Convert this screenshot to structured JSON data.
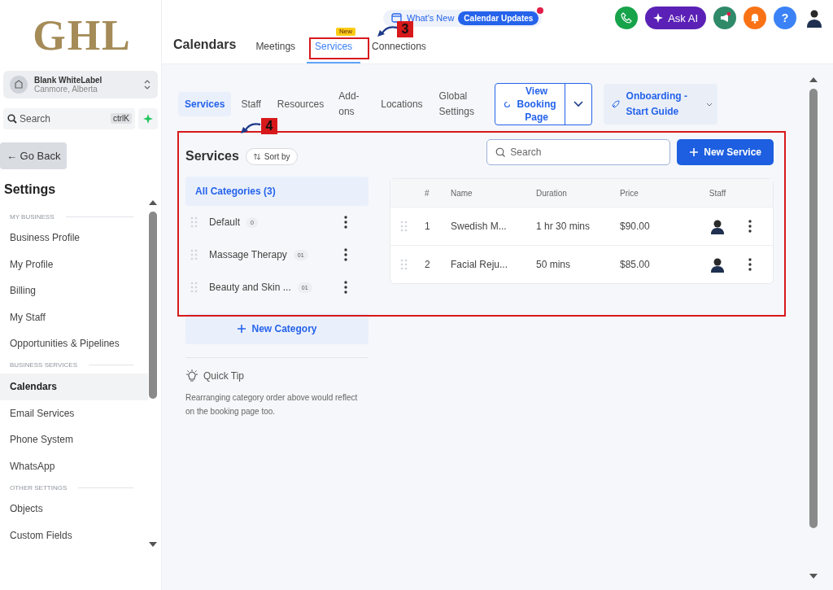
{
  "logo": "GHL",
  "account": {
    "name": "Blank WhiteLabel",
    "location": "Canmore, Alberta"
  },
  "sidebar_search": {
    "placeholder": "Search",
    "shortcut": "ctrlK"
  },
  "back_button": "← Go Back",
  "sidebar_title": "Settings",
  "sidebar_sections": [
    {
      "heading": "MY BUSINESS",
      "items": [
        {
          "label": "Business Profile",
          "selected": false
        },
        {
          "label": "My Profile",
          "selected": false
        },
        {
          "label": "Billing",
          "selected": false
        },
        {
          "label": "My Staff",
          "selected": false
        },
        {
          "label": "Opportunities & Pipelines",
          "selected": false
        }
      ]
    },
    {
      "heading": "BUSINESS SERVICES",
      "items": [
        {
          "label": "Calendars",
          "selected": true
        },
        {
          "label": "Email Services",
          "selected": false
        },
        {
          "label": "Phone System",
          "selected": false
        },
        {
          "label": "WhatsApp",
          "selected": false
        }
      ]
    },
    {
      "heading": "OTHER SETTINGS",
      "items": [
        {
          "label": "Objects",
          "selected": false
        },
        {
          "label": "Custom Fields",
          "selected": false
        }
      ]
    }
  ],
  "header": {
    "whats_new": "What's New",
    "updates": "Calendar Updates",
    "ask_ai": "Ask AI",
    "help": "?"
  },
  "page_title": "Calendars",
  "tabs": [
    {
      "label": "Meetings",
      "selected": false
    },
    {
      "label": "Services",
      "selected": true,
      "badge": "New"
    },
    {
      "label": "Connections",
      "selected": false
    }
  ],
  "subtabs": [
    {
      "label": "Services",
      "selected": true
    },
    {
      "label": "Staff",
      "selected": false
    },
    {
      "label": "Resources",
      "selected": false
    },
    {
      "label": "Add-ons",
      "selected": false
    },
    {
      "label": "Locations",
      "selected": false
    },
    {
      "label": "Global Settings",
      "selected": false
    }
  ],
  "view_booking": "View Booking Page",
  "onboarding": "Onboarding - Start Guide",
  "services": {
    "title": "Services",
    "sort": "Sort by",
    "all_categories": "All Categories (3)",
    "categories": [
      {
        "name": "Default",
        "count": "0"
      },
      {
        "name": "Massage Therapy",
        "count": "01"
      },
      {
        "name": "Beauty and Skin ...",
        "count": "01"
      }
    ],
    "search_placeholder": "Search",
    "new_service": "New Service",
    "new_category": "New Category",
    "columns": [
      "#",
      "Name",
      "Duration",
      "Price",
      "Staff"
    ],
    "rows": [
      {
        "number": "1",
        "name": "Swedish M...",
        "duration": "1 hr 30 mins",
        "price": "$90.00"
      },
      {
        "number": "2",
        "name": "Facial Reju...",
        "duration": "50 mins",
        "price": "$85.00"
      }
    ]
  },
  "quick_tip": {
    "title": "Quick Tip",
    "text": "Rearranging category order above would reflect on the booking page too."
  },
  "annotations": [
    {
      "number": "3"
    },
    {
      "number": "4"
    }
  ]
}
